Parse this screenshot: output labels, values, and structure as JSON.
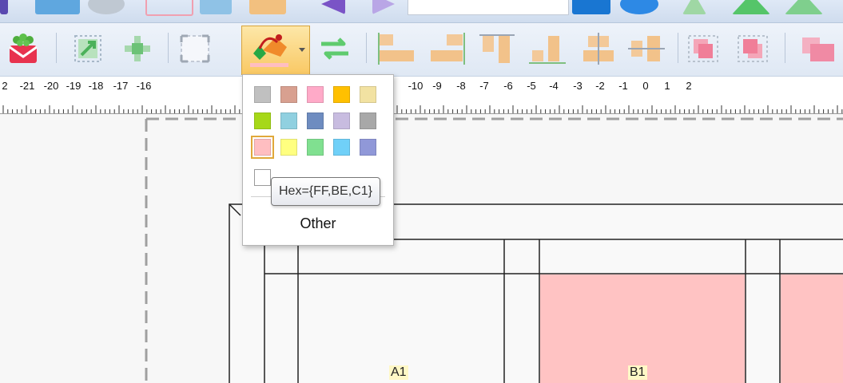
{
  "app": {
    "toolbar_top": {
      "search_value": ""
    },
    "colors": {
      "toolbar_bg": "#dfe8f4",
      "accent_active": "#f9c863",
      "canvas_bg": "#f7f7f7",
      "cell_pink": "#ffc3c3",
      "label_highlight": "#fff8c6"
    }
  },
  "toolbar": {
    "buttons": [
      {
        "name": "gift-icon"
      },
      {
        "name": "resize-expand-icon"
      },
      {
        "name": "add-node-icon"
      },
      {
        "name": "select-frame-icon"
      },
      {
        "name": "fill-color-icon"
      },
      {
        "name": "swap-arrows-icon"
      },
      {
        "name": "align-left-icon"
      },
      {
        "name": "align-right-icon"
      },
      {
        "name": "align-top-icon"
      },
      {
        "name": "align-bottom-icon"
      },
      {
        "name": "align-center-horizontal-icon"
      },
      {
        "name": "align-center-vertical-icon"
      },
      {
        "name": "bring-front-icon"
      },
      {
        "name": "send-back-icon"
      },
      {
        "name": "group-icon"
      }
    ]
  },
  "ruler": {
    "labels": [
      "2",
      "-21",
      "-20",
      "-19",
      "-18",
      "-17",
      "-16",
      "-10",
      "-9",
      "-8",
      "-7",
      "-6",
      "-5",
      "-4",
      "-3",
      "-2",
      "-1",
      "0",
      "1",
      "2"
    ]
  },
  "color_dropdown": {
    "swatches": [
      [
        "#c0c0c0",
        "#d8a090",
        "#ffaac8",
        "#ffc000",
        "#f2e2a2"
      ],
      [
        "#a6d818",
        "#90d0e0",
        "#6e8cc0",
        "#c8bce0",
        "#a8a8a8"
      ],
      [
        "#ffbec1",
        "#ffff80",
        "#80e090",
        "#70d0f8",
        "#9098d8"
      ]
    ],
    "selected_hex": "#ffbec1",
    "other_label": "Other"
  },
  "tooltip": {
    "text": "Hex={FF,BE,C1}"
  },
  "canvas": {
    "cells": [
      {
        "label": "A1",
        "fill": "#ffffff"
      },
      {
        "label": "B1",
        "fill": "#ffc3c3"
      }
    ]
  }
}
